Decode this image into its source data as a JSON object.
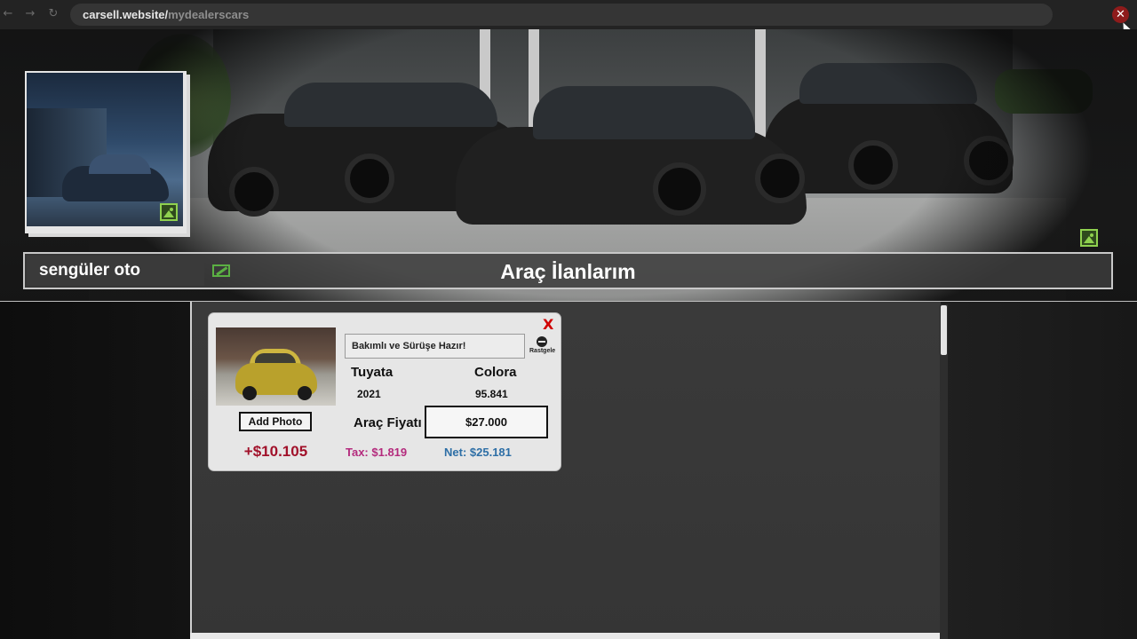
{
  "browser": {
    "url_host": "carsell.website/",
    "url_path": "mydealerscars",
    "back_icon": "arrow-left-icon",
    "forward_icon": "arrow-right-icon",
    "reload_icon": "reload-icon",
    "close_glyph": "✕"
  },
  "header": {
    "dealer_name": "sengüler oto",
    "page_title": "Araç İlanlarım"
  },
  "listing": {
    "close_glyph": "X",
    "add_photo_label": "Add Photo",
    "profit": "+$10.105",
    "description": "Bakımlı ve Sürüşe Hazır!",
    "random_label": "Rastgele",
    "brand": "Tuyata",
    "model": "Colora",
    "year": "2021",
    "km": "95.841",
    "price_label": "Araç Fiyatı",
    "price_value": "$27.000",
    "tax": "Tax: $1.819",
    "net": "Net: $25.181"
  },
  "colors": {
    "profit": "#a1112a",
    "tax": "#b42b7d",
    "net": "#2e6fa6",
    "close": "#d00000",
    "image_icon": "#8fd14f"
  }
}
